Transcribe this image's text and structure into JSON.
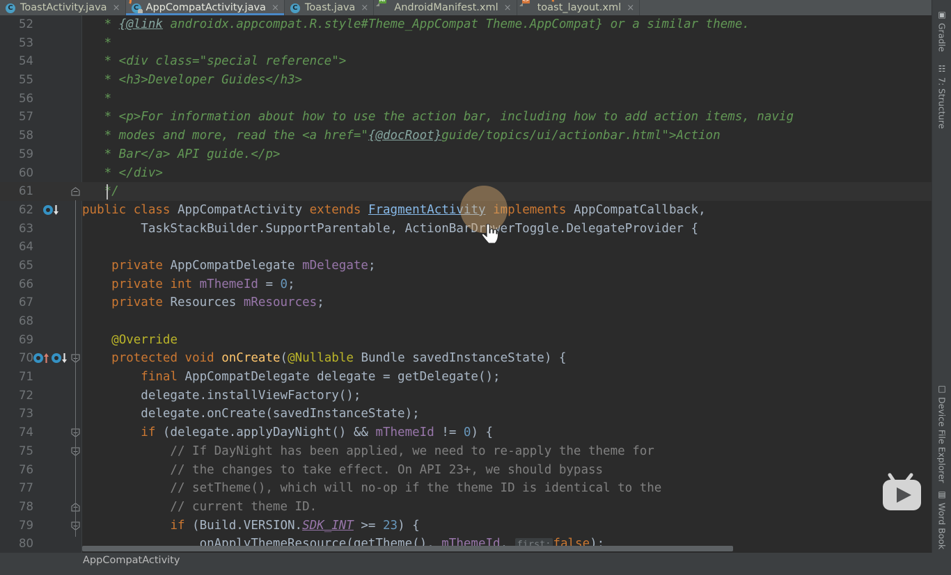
{
  "window": {
    "app": "Android Studio",
    "theme_accent": "#4a88c7",
    "editor_bg": "#2b2b2b",
    "gutter_bg": "#313335",
    "chrome_bg": "#3c3f41"
  },
  "tabs": [
    {
      "label": "ToastActivity.java",
      "icon": "java-class-icon",
      "active": false,
      "close": "×"
    },
    {
      "label": "AppCompatActivity.java",
      "icon": "java-class-locked-icon",
      "active": true,
      "close": "×"
    },
    {
      "label": "Toast.java",
      "icon": "java-class-icon",
      "active": false,
      "close": "×"
    },
    {
      "label": "AndroidManifest.xml",
      "icon": "xml-manifest-icon",
      "active": false,
      "close": "×",
      "badge": "MF"
    },
    {
      "label": "toast_layout.xml",
      "icon": "xml-layout-icon",
      "active": false,
      "close": "×",
      "badge": "<>"
    }
  ],
  "editor": {
    "first_line": 52,
    "caret_line": 61,
    "inline_hint": "first:",
    "lines": [
      {
        "n": 52,
        "tokens": [
          {
            "t": "   * ",
            "c": "cmt"
          },
          {
            "t": "{@link",
            "c": "lnk"
          },
          {
            "t": " androidx.appcompat.R.style#Theme_AppCompat Theme.AppCompat} or a similar theme.",
            "c": "cmt"
          }
        ]
      },
      {
        "n": 53,
        "tokens": [
          {
            "t": "   *",
            "c": "cmt"
          }
        ]
      },
      {
        "n": 54,
        "tokens": [
          {
            "t": "   * <div class=\"special reference\">",
            "c": "cmt"
          }
        ]
      },
      {
        "n": 55,
        "tokens": [
          {
            "t": "   * <h3>Developer Guides</h3>",
            "c": "cmt"
          }
        ]
      },
      {
        "n": 56,
        "tokens": [
          {
            "t": "   *",
            "c": "cmt"
          }
        ]
      },
      {
        "n": 57,
        "tokens": [
          {
            "t": "   * <p>For information about how to use the action bar, including how to add action items, navig",
            "c": "cmt"
          }
        ]
      },
      {
        "n": 58,
        "tokens": [
          {
            "t": "   * modes and more, read the <a href=\"",
            "c": "cmt"
          },
          {
            "t": "{@docRoot}",
            "c": "lnk"
          },
          {
            "t": "guide/topics/ui/actionbar.html\">Action",
            "c": "cmt"
          }
        ]
      },
      {
        "n": 59,
        "tokens": [
          {
            "t": "   * Bar</a> API guide.</p>",
            "c": "cmt"
          }
        ]
      },
      {
        "n": 60,
        "tokens": [
          {
            "t": "   * </div>",
            "c": "cmt"
          }
        ]
      },
      {
        "n": 61,
        "tokens": [
          {
            "t": "   */",
            "c": "cmt"
          }
        ]
      },
      {
        "n": 62,
        "tokens": [
          {
            "t": "public",
            "c": "kw"
          },
          {
            "t": " ",
            "c": "typ"
          },
          {
            "t": "class",
            "c": "kw"
          },
          {
            "t": " AppCompatActivity ",
            "c": "typ"
          },
          {
            "t": "extends",
            "c": "kw"
          },
          {
            "t": " ",
            "c": "typ"
          },
          {
            "t": "FragmentActivity",
            "c": "lnk-hover"
          },
          {
            "t": " ",
            "c": "typ"
          },
          {
            "t": "implements",
            "c": "kw"
          },
          {
            "t": " AppCompatCallback,",
            "c": "typ"
          }
        ]
      },
      {
        "n": 63,
        "tokens": [
          {
            "t": "        TaskStackBuilder.SupportParentable, ActionBarDrawerToggle.DelegateProvider {",
            "c": "typ"
          }
        ]
      },
      {
        "n": 64,
        "tokens": []
      },
      {
        "n": 65,
        "tokens": [
          {
            "t": "    ",
            "c": "typ"
          },
          {
            "t": "private",
            "c": "kw"
          },
          {
            "t": " AppCompatDelegate ",
            "c": "typ"
          },
          {
            "t": "mDelegate",
            "c": "fld"
          },
          {
            "t": ";",
            "c": "typ"
          }
        ]
      },
      {
        "n": 66,
        "tokens": [
          {
            "t": "    ",
            "c": "typ"
          },
          {
            "t": "private",
            "c": "kw"
          },
          {
            "t": " ",
            "c": "typ"
          },
          {
            "t": "int",
            "c": "kw"
          },
          {
            "t": " ",
            "c": "typ"
          },
          {
            "t": "mThemeId",
            "c": "fld"
          },
          {
            "t": " = ",
            "c": "typ"
          },
          {
            "t": "0",
            "c": "num"
          },
          {
            "t": ";",
            "c": "typ"
          }
        ]
      },
      {
        "n": 67,
        "tokens": [
          {
            "t": "    ",
            "c": "typ"
          },
          {
            "t": "private",
            "c": "kw"
          },
          {
            "t": " Resources ",
            "c": "typ"
          },
          {
            "t": "mResources",
            "c": "fld"
          },
          {
            "t": ";",
            "c": "typ"
          }
        ]
      },
      {
        "n": 68,
        "tokens": []
      },
      {
        "n": 69,
        "tokens": [
          {
            "t": "    ",
            "c": "typ"
          },
          {
            "t": "@Override",
            "c": "ann"
          }
        ]
      },
      {
        "n": 70,
        "tokens": [
          {
            "t": "    ",
            "c": "typ"
          },
          {
            "t": "protected",
            "c": "kw"
          },
          {
            "t": " ",
            "c": "typ"
          },
          {
            "t": "void",
            "c": "kw"
          },
          {
            "t": " ",
            "c": "typ"
          },
          {
            "t": "onCreate",
            "c": "mth"
          },
          {
            "t": "(",
            "c": "typ"
          },
          {
            "t": "@Nullable",
            "c": "ann"
          },
          {
            "t": " Bundle savedInstanceState) {",
            "c": "typ"
          }
        ]
      },
      {
        "n": 71,
        "tokens": [
          {
            "t": "        ",
            "c": "typ"
          },
          {
            "t": "final",
            "c": "kw"
          },
          {
            "t": " AppCompatDelegate delegate = getDelegate();",
            "c": "typ"
          }
        ]
      },
      {
        "n": 72,
        "tokens": [
          {
            "t": "        delegate.installViewFactory();",
            "c": "typ"
          }
        ]
      },
      {
        "n": 73,
        "tokens": [
          {
            "t": "        delegate.onCreate(savedInstanceState);",
            "c": "typ"
          }
        ]
      },
      {
        "n": 74,
        "tokens": [
          {
            "t": "        ",
            "c": "typ"
          },
          {
            "t": "if",
            "c": "kw"
          },
          {
            "t": " (delegate.applyDayNight() && ",
            "c": "typ"
          },
          {
            "t": "mThemeId",
            "c": "fld"
          },
          {
            "t": " != ",
            "c": "typ"
          },
          {
            "t": "0",
            "c": "num"
          },
          {
            "t": ") {",
            "c": "typ"
          }
        ]
      },
      {
        "n": 75,
        "tokens": [
          {
            "t": "            // If DayNight has been applied, we need to re-apply the theme for",
            "c": "lc"
          }
        ]
      },
      {
        "n": 76,
        "tokens": [
          {
            "t": "            // the changes to take effect. On API 23+, we should bypass",
            "c": "lc"
          }
        ]
      },
      {
        "n": 77,
        "tokens": [
          {
            "t": "            // setTheme(), which will no-op if the theme ID is identical to the",
            "c": "lc"
          }
        ]
      },
      {
        "n": 78,
        "tokens": [
          {
            "t": "            // current theme ID.",
            "c": "lc"
          }
        ]
      },
      {
        "n": 79,
        "tokens": [
          {
            "t": "            ",
            "c": "typ"
          },
          {
            "t": "if",
            "c": "kw"
          },
          {
            "t": " (Build.VERSION.",
            "c": "typ"
          },
          {
            "t": "SDK_INT",
            "c": "sfld"
          },
          {
            "t": " >= ",
            "c": "typ"
          },
          {
            "t": "23",
            "c": "num"
          },
          {
            "t": ") {",
            "c": "typ"
          }
        ]
      },
      {
        "n": 80,
        "tokens": [
          {
            "t": "                onApplyThemeResource(getTheme(), ",
            "c": "typ"
          },
          {
            "t": "mThemeId",
            "c": "fld"
          },
          {
            "t": ", ",
            "c": "typ"
          },
          {
            "t": "@HINT@",
            "c": "hint"
          },
          {
            "t": "false",
            "c": "kw"
          },
          {
            "t": ");",
            "c": "typ"
          }
        ]
      }
    ],
    "gutter_marks": [
      {
        "line": 62,
        "kinds": [
          "implemented-down"
        ]
      },
      {
        "line": 70,
        "kinds": [
          "overrides-up",
          "implemented-down"
        ]
      }
    ],
    "fold_markers": [
      {
        "line": 61,
        "dir": "up"
      },
      {
        "line": 70,
        "dir": "down"
      },
      {
        "line": 74,
        "dir": "down"
      },
      {
        "line": 75,
        "dir": "down"
      },
      {
        "line": 78,
        "dir": "up"
      },
      {
        "line": 79,
        "dir": "down"
      }
    ],
    "inspection_status": "✓"
  },
  "right_sidebar": {
    "items": [
      {
        "label": "Gradle",
        "icon": "gradle-elephant-icon"
      },
      {
        "label": "7: Structure",
        "icon": "structure-icon"
      },
      {
        "label": "Device File Explorer",
        "icon": "device-file-explorer-icon"
      },
      {
        "label": "Word Book",
        "icon": "word-book-icon"
      }
    ]
  },
  "status": {
    "breadcrumb": "AppCompatActivity"
  },
  "overlay": {
    "watermark": "screen-recorder-tv-icon"
  }
}
